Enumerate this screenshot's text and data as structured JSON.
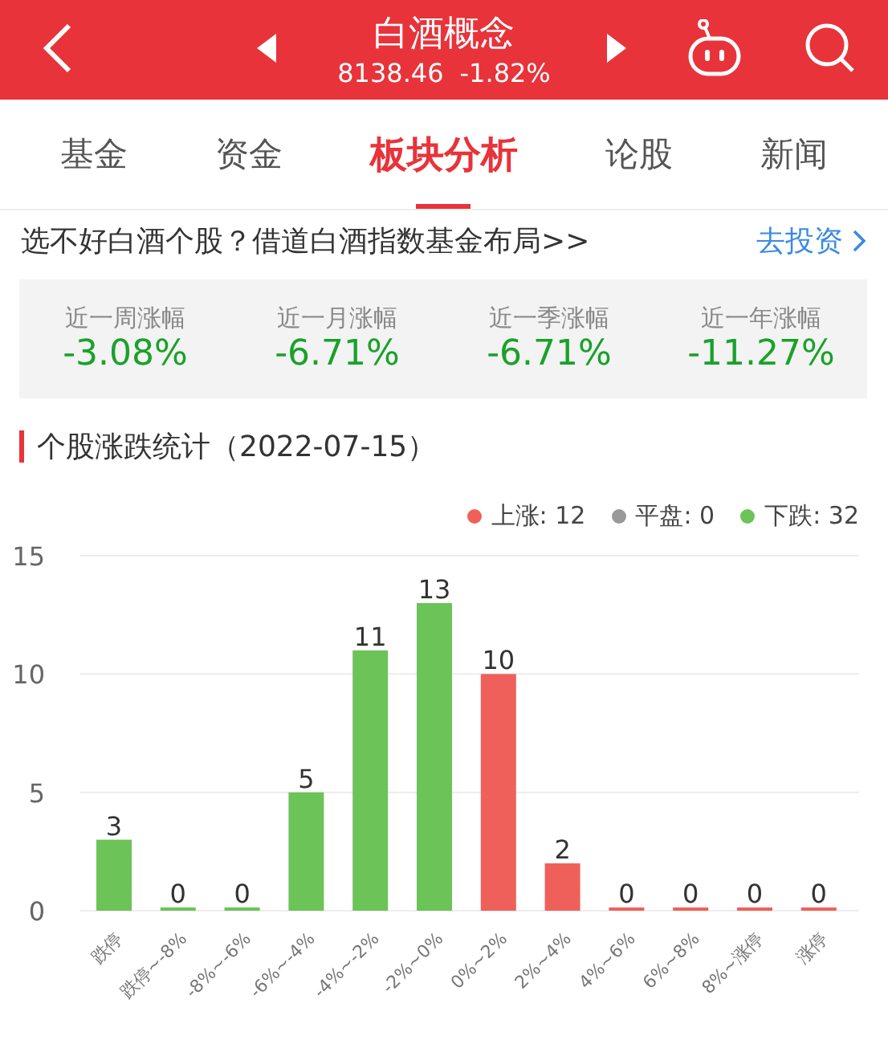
{
  "header": {
    "title": "白酒概念",
    "price": "8138.46",
    "change": "-1.82%"
  },
  "tabs": [
    {
      "label": "基金",
      "selected": false
    },
    {
      "label": "资金",
      "selected": false
    },
    {
      "label": "板块分析",
      "selected": true
    },
    {
      "label": "论股",
      "selected": false
    },
    {
      "label": "新闻",
      "selected": false
    }
  ],
  "banner": {
    "text": "选不好白酒个股？借道白酒指数基金布局>>",
    "link": "去投资"
  },
  "stats": [
    {
      "label": "近一周涨幅",
      "value": "-3.08%"
    },
    {
      "label": "近一月涨幅",
      "value": "-6.71%"
    },
    {
      "label": "近一季涨幅",
      "value": "-6.71%"
    },
    {
      "label": "近一年涨幅",
      "value": "-11.27%"
    }
  ],
  "section": {
    "title": "个股涨跌统计（2022-07-15）"
  },
  "chart_data": {
    "type": "bar",
    "categories": [
      "跌停",
      "跌停~-8%",
      "-8%~-6%",
      "-6%~-4%",
      "-4%~-2%",
      "-2%~0%",
      "0%~2%",
      "2%~4%",
      "4%~6%",
      "6%~8%",
      "8%~涨停",
      "涨停"
    ],
    "series": [
      {
        "name": "上涨: 12",
        "color": "#f0605a",
        "values": [
          null,
          null,
          null,
          null,
          null,
          null,
          10,
          2,
          0,
          0,
          0,
          0
        ]
      },
      {
        "name": "平盘: 0",
        "color": "#999999",
        "values": [
          null,
          null,
          null,
          null,
          null,
          null,
          null,
          null,
          null,
          null,
          null,
          null
        ]
      },
      {
        "name": "下跌: 32",
        "color": "#6cc358",
        "values": [
          3,
          0,
          0,
          5,
          11,
          13,
          null,
          null,
          null,
          null,
          null,
          null
        ]
      }
    ],
    "ylim": [
      0,
      15
    ],
    "yticks": [
      0,
      5,
      10,
      15
    ],
    "stacked": true,
    "data_labels": true
  }
}
